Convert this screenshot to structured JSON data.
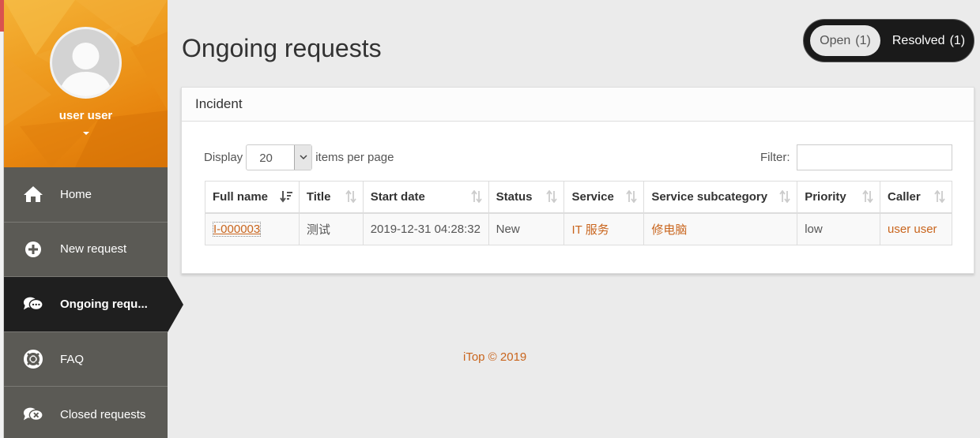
{
  "user": {
    "name": "user user"
  },
  "sidebar": {
    "items": [
      {
        "label": "Home",
        "icon": "home-icon"
      },
      {
        "label": "New request",
        "icon": "plus-circle-icon"
      },
      {
        "label": "Ongoing requ...",
        "icon": "chat-bubbles-icon",
        "active": true
      },
      {
        "label": "FAQ",
        "icon": "lifebuoy-icon"
      },
      {
        "label": "Closed requests",
        "icon": "chat-closed-icon"
      }
    ]
  },
  "page": {
    "title": "Ongoing requests"
  },
  "toggle": {
    "open_label": "Open",
    "open_count": "(1)",
    "resolved_label": "Resolved",
    "resolved_count": "(1)"
  },
  "panel": {
    "title": "Incident",
    "display_label": "Display",
    "page_size": "20",
    "items_per_page_label": "items per page",
    "filter_label": "Filter:",
    "filter_value": ""
  },
  "table": {
    "columns": [
      "Full name",
      "Title",
      "Start date",
      "Status",
      "Service",
      "Service subcategory",
      "Priority",
      "Caller"
    ],
    "rows": [
      {
        "full_name": "I-000003",
        "title": "测试",
        "start_date": "2019-12-31 04:28:32",
        "status": "New",
        "service": "IT 服务",
        "service_subcategory": "修电脑",
        "priority": "low",
        "caller": "user user"
      }
    ]
  },
  "footer": {
    "text": "iTop © 2019"
  },
  "colors": {
    "accent": "#c9651d",
    "sidebar": "#5b5a55",
    "active": "#1f1f1f",
    "header_orange": "#ee9a1e"
  }
}
